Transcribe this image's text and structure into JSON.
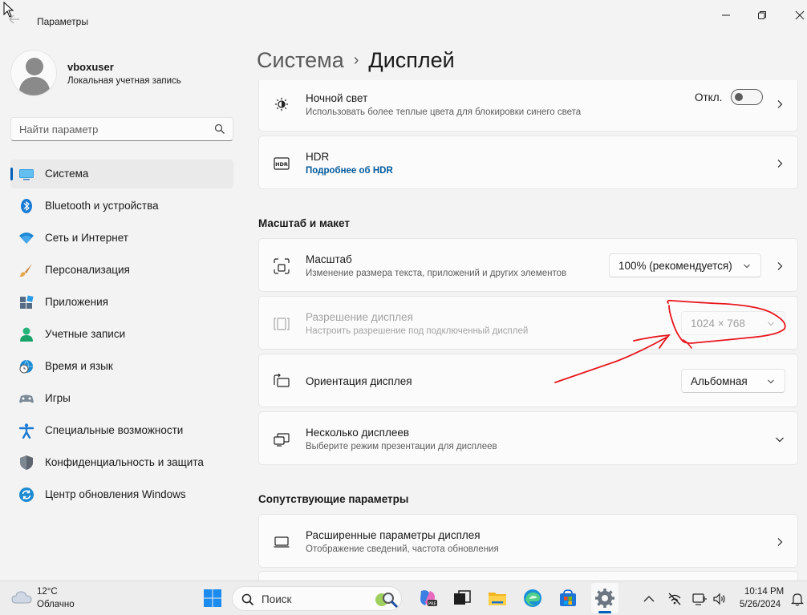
{
  "window": {
    "title": "Параметры",
    "controls": [
      "minimize-icon",
      "maximize-icon",
      "close-icon"
    ]
  },
  "profile": {
    "name": "vboxuser",
    "account_type": "Локальная учетная запись"
  },
  "search": {
    "placeholder": "Найти параметр"
  },
  "sidebar": {
    "items": [
      {
        "label": "Система",
        "icon": "system-icon",
        "active": true
      },
      {
        "label": "Bluetooth и устройства",
        "icon": "bluetooth-icon"
      },
      {
        "label": "Сеть и Интернет",
        "icon": "wifi-icon"
      },
      {
        "label": "Персонализация",
        "icon": "brush-icon"
      },
      {
        "label": "Приложения",
        "icon": "apps-icon"
      },
      {
        "label": "Учетные записи",
        "icon": "user-icon"
      },
      {
        "label": "Время и язык",
        "icon": "globe-clock-icon"
      },
      {
        "label": "Игры",
        "icon": "gamepad-icon"
      },
      {
        "label": "Специальные возможности",
        "icon": "accessibility-icon"
      },
      {
        "label": "Конфиденциальность и защита",
        "icon": "shield-icon"
      },
      {
        "label": "Центр обновления Windows",
        "icon": "update-icon"
      }
    ]
  },
  "breadcrumb": {
    "parent": "Система",
    "separator": "›",
    "current": "Дисплей"
  },
  "settings": {
    "night_light": {
      "title": "Ночной свет",
      "subtitle": "Использовать более теплые цвета для блокировки синего света",
      "toggle_label": "Откл.",
      "toggle_on": false
    },
    "hdr": {
      "title": "HDR",
      "link": "Подробнее об HDR"
    },
    "section_scale": "Масштаб и макет",
    "scale": {
      "title": "Масштаб",
      "subtitle": "Изменение размера текста, приложений и других элементов",
      "value": "100% (рекомендуется)"
    },
    "resolution": {
      "title": "Разрешение дисплея",
      "subtitle": "Настроить разрешение под подключенный дисплей",
      "value": "1024 × 768",
      "disabled": true
    },
    "orientation": {
      "title": "Ориентация дисплея",
      "value": "Альбомная"
    },
    "multiple": {
      "title": "Несколько дисплеев",
      "subtitle": "Выберите режим презентации для дисплеев"
    },
    "section_related": "Сопутствующие параметры",
    "advanced": {
      "title": "Расширенные параметры дисплея",
      "subtitle": "Отображение сведений, частота обновления"
    }
  },
  "annotation": {
    "color": "#e8141c",
    "shape": "hand-drawn circle and arrow pointing at resolution dropdown"
  },
  "taskbar": {
    "weather_temp": "12°C",
    "weather_desc": "Облачно",
    "search_label": "Поиск",
    "time": "10:14 PM",
    "date": "5/26/2024"
  },
  "colors": {
    "accent": "#005fb8",
    "background": "#f3f3f3",
    "card": "#fbfbfb"
  }
}
